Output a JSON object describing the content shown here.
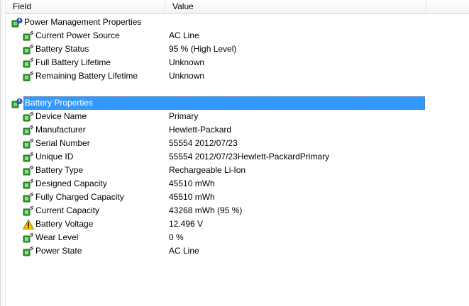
{
  "columns": {
    "field": "Field",
    "value": "Value"
  },
  "groups": [
    {
      "title": "Power Management Properties",
      "icon": "power-management-icon",
      "items": [
        {
          "field": "Current Power Source",
          "value": "AC Line",
          "icon": "battery-green-icon"
        },
        {
          "field": "Battery Status",
          "value": "95 % (High Level)",
          "icon": "battery-green-icon"
        },
        {
          "field": "Full Battery Lifetime",
          "value": "Unknown",
          "icon": "battery-green-icon"
        },
        {
          "field": "Remaining Battery Lifetime",
          "value": "Unknown",
          "icon": "battery-green-icon"
        }
      ]
    },
    {
      "title": "Battery Properties",
      "icon": "power-management-icon",
      "selected": true,
      "items": [
        {
          "field": "Device Name",
          "value": "Primary",
          "icon": "battery-green-icon"
        },
        {
          "field": "Manufacturer",
          "value": "Hewlett-Packard",
          "icon": "battery-green-icon"
        },
        {
          "field": "Serial Number",
          "value": "55554 2012/07/23",
          "icon": "battery-green-icon"
        },
        {
          "field": "Unique ID",
          "value": "55554 2012/07/23Hewlett-PackardPrimary",
          "icon": "battery-green-icon"
        },
        {
          "field": "Battery Type",
          "value": "Rechargeable Li-Ion",
          "icon": "battery-green-icon"
        },
        {
          "field": "Designed Capacity",
          "value": "45510 mWh",
          "icon": "battery-green-icon"
        },
        {
          "field": "Fully Charged Capacity",
          "value": "45510 mWh",
          "icon": "battery-green-icon"
        },
        {
          "field": "Current Capacity",
          "value": "43268 mWh  (95 %)",
          "icon": "battery-green-icon"
        },
        {
          "field": "Battery Voltage",
          "value": "12.496 V",
          "icon": "warning-icon"
        },
        {
          "field": "Wear Level",
          "value": "0 %",
          "icon": "battery-green-icon"
        },
        {
          "field": "Power State",
          "value": "AC Line",
          "icon": "battery-green-icon"
        }
      ]
    }
  ],
  "colors": {
    "selection": "#3399ff",
    "battery": "#2e9e2e",
    "plug": "#3a6fd0",
    "warning": "#f2c200"
  }
}
